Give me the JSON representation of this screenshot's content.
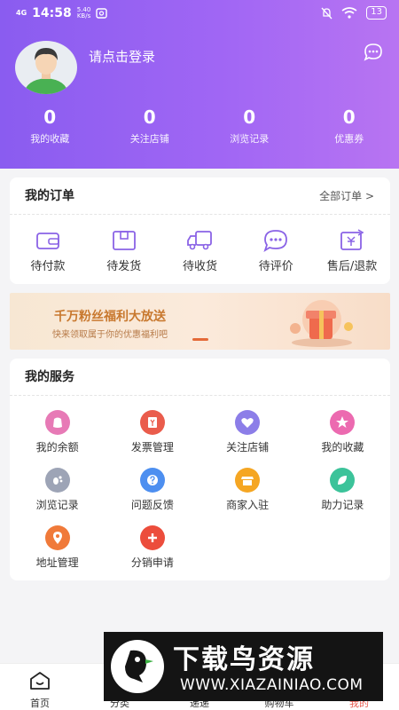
{
  "status_bar": {
    "network": "4G",
    "time": "14:58",
    "speed_value": "5.40",
    "speed_unit": "KB/s",
    "battery": "13"
  },
  "profile": {
    "login_prompt": "请点击登录"
  },
  "stats": [
    {
      "value": "0",
      "label": "我的收藏"
    },
    {
      "value": "0",
      "label": "关注店铺"
    },
    {
      "value": "0",
      "label": "浏览记录"
    },
    {
      "value": "0",
      "label": "优惠券"
    }
  ],
  "orders": {
    "title": "我的订单",
    "all_link": "全部订单 >",
    "items": [
      {
        "label": "待付款",
        "icon": "wallet-icon"
      },
      {
        "label": "待发货",
        "icon": "package-icon"
      },
      {
        "label": "待收货",
        "icon": "truck-icon"
      },
      {
        "label": "待评价",
        "icon": "comment-icon"
      },
      {
        "label": "售后/退款",
        "icon": "refund-icon"
      }
    ]
  },
  "banner": {
    "title": "千万粉丝福利大放送",
    "subtitle": "快来领取属于你的优惠福利吧"
  },
  "services": {
    "title": "我的服务",
    "items": [
      {
        "label": "我的余额",
        "icon": "balance-icon",
        "color": "#e77ab6"
      },
      {
        "label": "发票管理",
        "icon": "invoice-icon",
        "color": "#ea5c4c"
      },
      {
        "label": "关注店铺",
        "icon": "heart-icon",
        "color": "#8c7ee8"
      },
      {
        "label": "我的收藏",
        "icon": "star-icon",
        "color": "#ec6ab0"
      },
      {
        "label": "浏览记录",
        "icon": "footprint-icon",
        "color": "#9da4b6"
      },
      {
        "label": "问题反馈",
        "icon": "question-icon",
        "color": "#4d8ff0"
      },
      {
        "label": "商家入驻",
        "icon": "store-icon",
        "color": "#f5a623"
      },
      {
        "label": "助力记录",
        "icon": "leaf-icon",
        "color": "#3cc39a"
      },
      {
        "label": "地址管理",
        "icon": "location-icon",
        "color": "#f07a3a"
      },
      {
        "label": "分销申请",
        "icon": "plus-icon",
        "color": "#ec4d3c"
      }
    ]
  },
  "tabbar": [
    {
      "label": "首页",
      "icon": "home-icon"
    },
    {
      "label": "分类",
      "icon": "category-icon"
    },
    {
      "label": "递递",
      "icon": "feed-icon"
    },
    {
      "label": "购物车",
      "icon": "cart-icon"
    },
    {
      "label": "我的",
      "icon": "user-icon"
    }
  ],
  "watermark": {
    "main": "下载鸟资源",
    "url": "WWW.XIAZAINIAO.COM"
  },
  "colors": {
    "header_start": "#8a5cf0",
    "header_end": "#b874f2",
    "accent": "#8a63e6",
    "active_tab": "#e85a4f"
  }
}
